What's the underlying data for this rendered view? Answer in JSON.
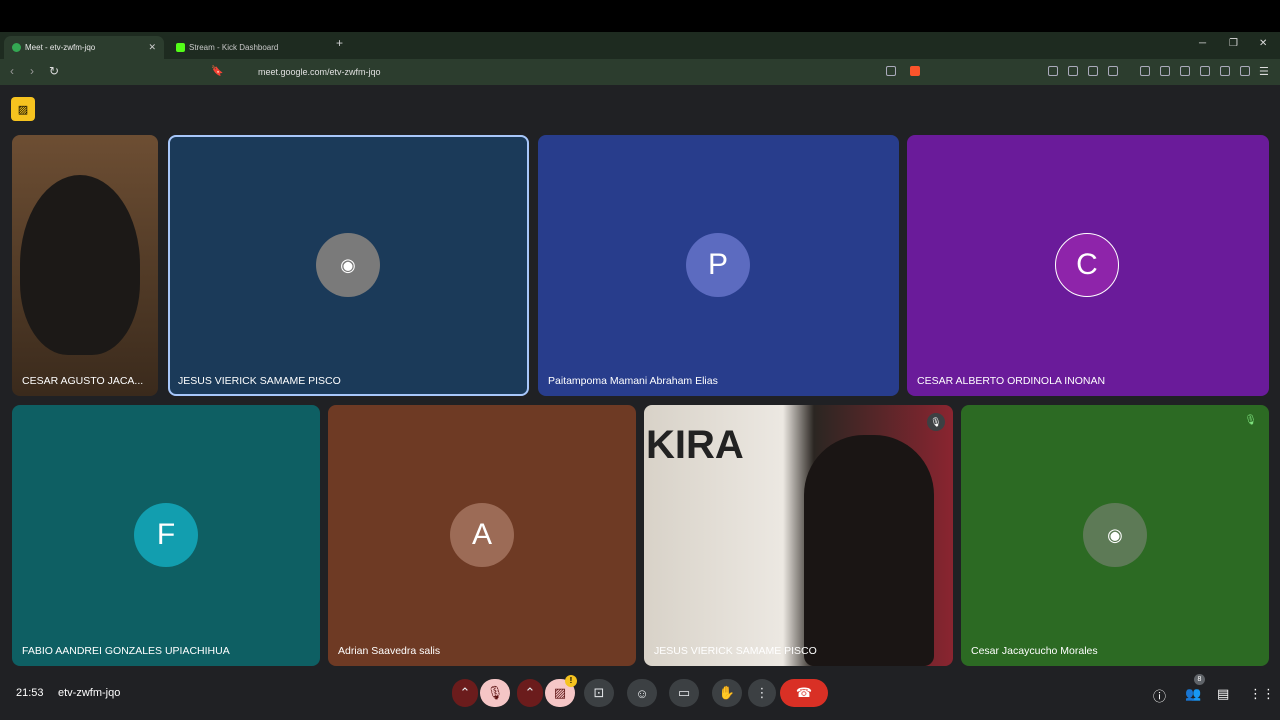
{
  "browser": {
    "tabs": [
      {
        "label": "Meet - etv-zwfm-jqo"
      },
      {
        "label": "Stream - Kick Dashboard"
      }
    ],
    "url": "meet.google.com/etv-zwfm-jqo"
  },
  "meeting": {
    "time": "21:53",
    "code": "etv-zwfm-jqo",
    "participants_count": "8"
  },
  "tiles": [
    {
      "name": "CESAR AGUSTO JACA..."
    },
    {
      "name": "JESUS VIERICK SAMAME PISCO"
    },
    {
      "name": "Paitampoma Mamani Abraham Elias",
      "initial": "P"
    },
    {
      "name": "CESAR ALBERTO ORDINOLA INONAN",
      "initial": "C"
    },
    {
      "name": "FABIO AANDREI GONZALES UPIACHIHUA",
      "initial": "F"
    },
    {
      "name": "Adrian Saavedra salis",
      "initial": "A"
    },
    {
      "name": "JESUS VIERICK SAMAME PISCO"
    },
    {
      "name": "Cesar Jacaycucho Morales"
    }
  ],
  "icons": {
    "mic": "mic-off-icon",
    "cam": "camera-off-icon",
    "present": "present-icon",
    "emoji": "emoji-icon",
    "captions": "captions-icon",
    "hand": "raise-hand-icon",
    "more": "more-icon",
    "hangup": "hangup-icon",
    "info": "info-icon",
    "people": "people-icon",
    "chat": "chat-icon",
    "activities": "activities-icon"
  }
}
